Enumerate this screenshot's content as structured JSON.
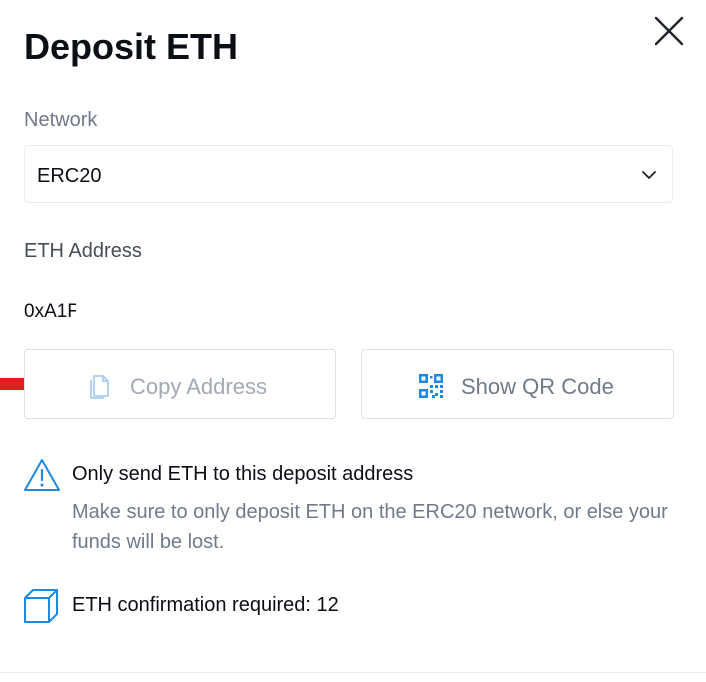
{
  "modal": {
    "title": "Deposit ETH",
    "close_icon": "close-icon"
  },
  "network": {
    "label": "Network",
    "selected": "ERC20",
    "chevron_icon": "chevron-down-icon"
  },
  "address": {
    "label": "ETH Address",
    "value": "0xA1F"
  },
  "actions": {
    "copy_label": "Copy Address",
    "copy_icon": "copy-icon",
    "qr_label": "Show QR Code",
    "qr_icon": "qr-code-icon"
  },
  "annotation": {
    "arrow_icon": "red-pointer-arrow",
    "arrow_color": "#e02020"
  },
  "warning": {
    "icon": "warning-triangle-icon",
    "title": "Only send ETH to this deposit address",
    "body": "Make sure to only deposit ETH on the ERC20 network, or else your funds will be lost."
  },
  "confirmation": {
    "icon": "cube-icon",
    "text": "ETH confirmation required: 12"
  },
  "colors": {
    "accent_blue": "#1e88e5",
    "text_primary": "#0b0e14",
    "text_secondary": "#707a8a",
    "border": "#dcdfe4"
  }
}
